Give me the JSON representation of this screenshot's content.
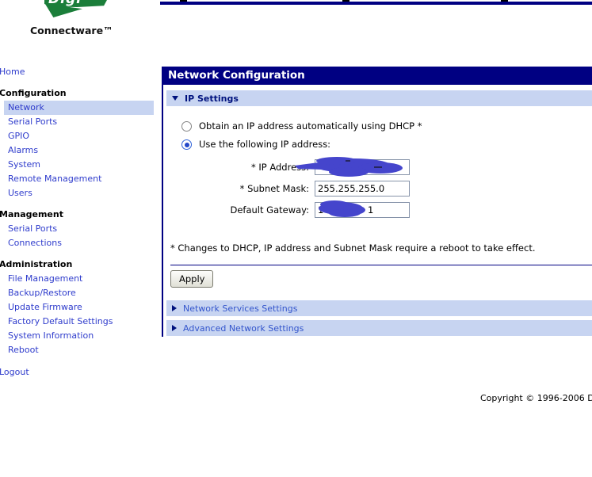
{
  "brand": {
    "logo_text": "Digi",
    "tagline": "Connectware™"
  },
  "sidebar": {
    "rows": [
      {
        "label": "Home",
        "cls": "toplink",
        "name": "sidebar-item-home",
        "interactable": true
      },
      {
        "label": "Configuration",
        "cls": "header",
        "name": "sidebar-section-configuration",
        "interactable": false
      },
      {
        "label": "Network",
        "cls": "item selected",
        "name": "sidebar-item-network",
        "interactable": true
      },
      {
        "label": "Serial Ports",
        "cls": "item",
        "name": "sidebar-item-serial-ports",
        "interactable": true
      },
      {
        "label": "GPIO",
        "cls": "item",
        "name": "sidebar-item-gpio",
        "interactable": true
      },
      {
        "label": "Alarms",
        "cls": "item",
        "name": "sidebar-item-alarms",
        "interactable": true
      },
      {
        "label": "System",
        "cls": "item",
        "name": "sidebar-item-system",
        "interactable": true
      },
      {
        "label": "Remote Management",
        "cls": "item",
        "name": "sidebar-item-remote-management",
        "interactable": true
      },
      {
        "label": "Users",
        "cls": "item",
        "name": "sidebar-item-users",
        "interactable": true
      },
      {
        "label": "Management",
        "cls": "header",
        "name": "sidebar-section-management",
        "interactable": false
      },
      {
        "label": "Serial Ports",
        "cls": "item",
        "name": "sidebar-item-management-serial-ports",
        "interactable": true
      },
      {
        "label": "Connections",
        "cls": "item",
        "name": "sidebar-item-connections",
        "interactable": true
      },
      {
        "label": "Administration",
        "cls": "header",
        "name": "sidebar-section-administration",
        "interactable": false
      },
      {
        "label": "File Management",
        "cls": "item",
        "name": "sidebar-item-file-management",
        "interactable": true
      },
      {
        "label": "Backup/Restore",
        "cls": "item",
        "name": "sidebar-item-backup-restore",
        "interactable": true
      },
      {
        "label": "Update Firmware",
        "cls": "item",
        "name": "sidebar-item-update-firmware",
        "interactable": true
      },
      {
        "label": "Factory Default Settings",
        "cls": "item",
        "name": "sidebar-item-factory-default-settings",
        "interactable": true
      },
      {
        "label": "System Information",
        "cls": "item",
        "name": "sidebar-item-system-information",
        "interactable": true
      },
      {
        "label": "Reboot",
        "cls": "item",
        "name": "sidebar-item-reboot",
        "interactable": true
      },
      {
        "label": "Logout",
        "cls": "toplink logout",
        "name": "sidebar-item-logout",
        "interactable": true
      }
    ]
  },
  "main": {
    "title": "Network Configuration",
    "ip_settings": {
      "label": "IP Settings",
      "dhcp_radio_label": "Obtain an IP address automatically using DHCP *",
      "static_radio_label": "Use the following IP address:",
      "ip_address_label": "* IP Address:",
      "ip_address_value": "",
      "ip_address_redacted": true,
      "subnet_mask_label": "* Subnet Mask:",
      "subnet_mask_value": "255.255.255.0",
      "gateway_label": "Default Gateway:",
      "gateway_value": "1",
      "gateway_visible_digit": "1",
      "gateway_redacted": true,
      "note": "* Changes to DHCP, IP address and Subnet Mask require a reboot to take effect.",
      "apply_label": "Apply"
    },
    "collapsed_sections": [
      {
        "label": "Network Services Settings",
        "name": "section-bar-network-services-settings",
        "interactable": true
      },
      {
        "label": "Advanced Network Settings",
        "name": "section-bar-advanced-network-settings",
        "interactable": true
      }
    ]
  },
  "footer": {
    "copyright": "Copyright © 1996-2006 D"
  },
  "colors": {
    "navy": "#000082",
    "bar_background": "#c7d4f1",
    "link_blue": "#2f3ccc",
    "section_label_navy": "#00127e",
    "collapsed_label_blue": "#3355cc",
    "logo_green": "#1b7e3a",
    "redaction_blue": "#4545cc"
  }
}
